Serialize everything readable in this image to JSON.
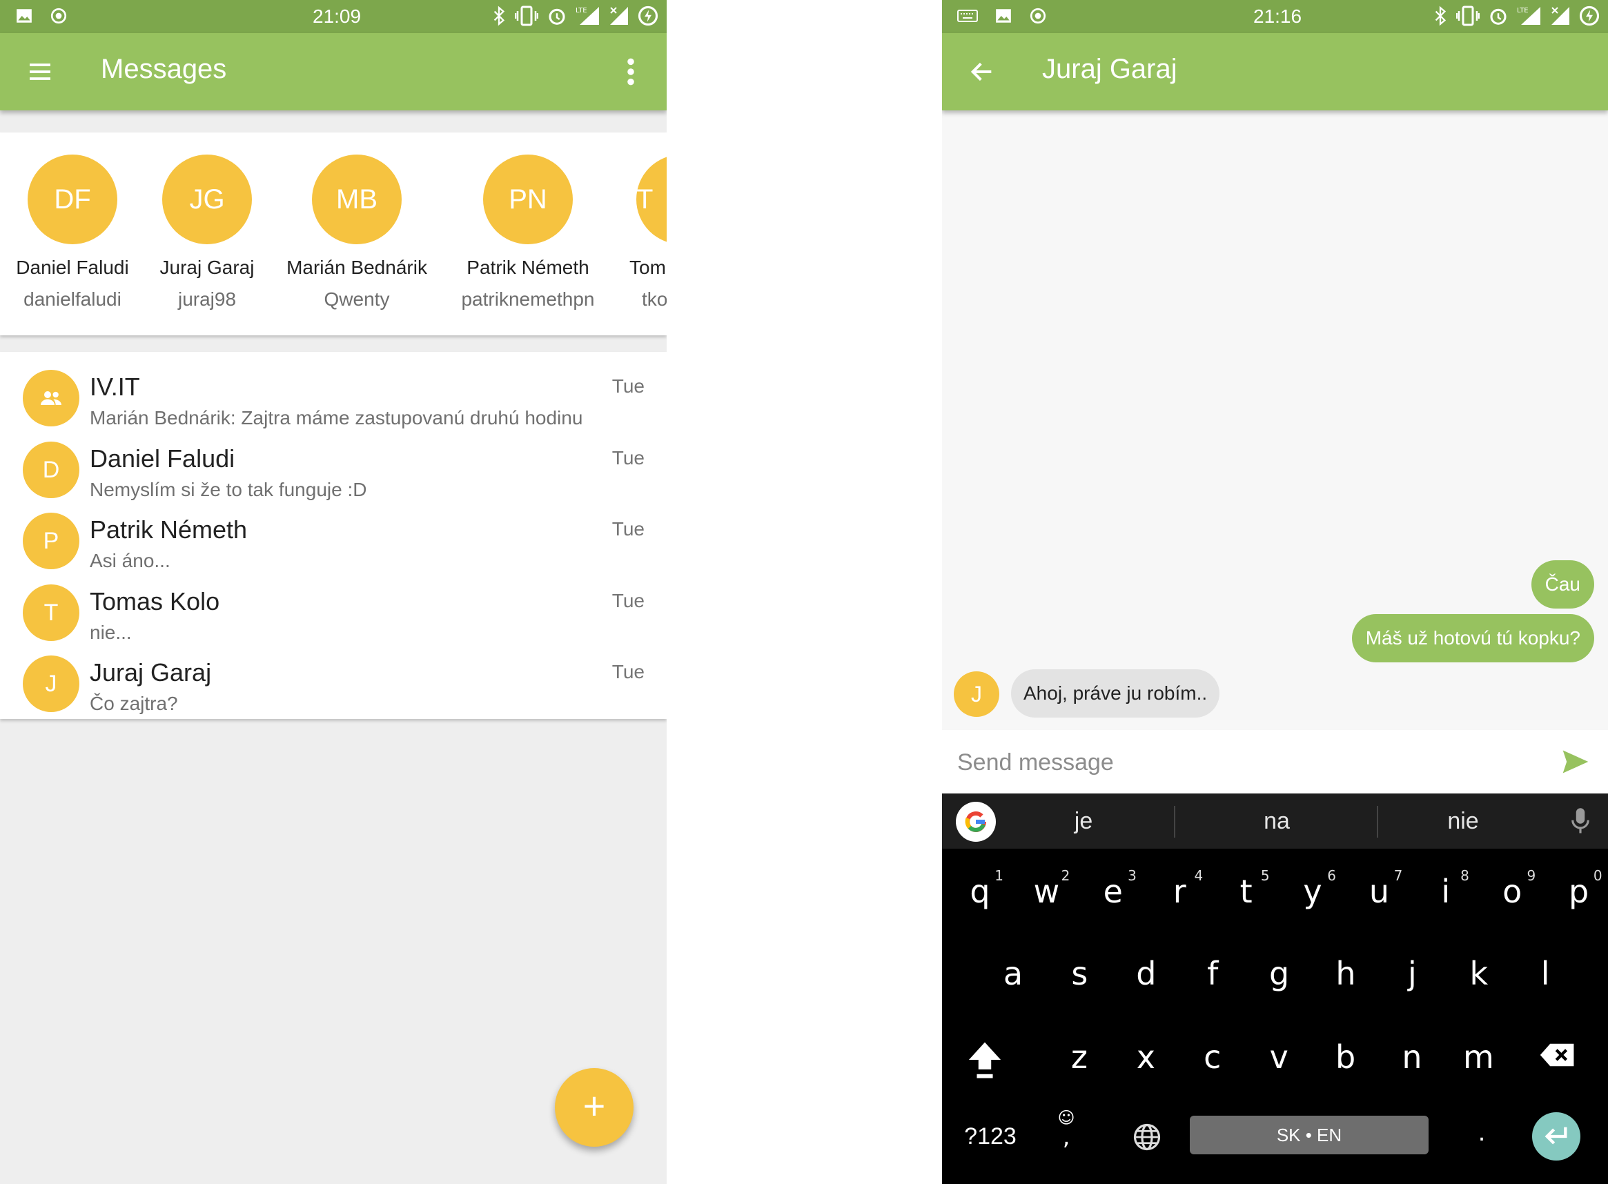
{
  "left": {
    "status": {
      "time": "21:09"
    },
    "appbar": {
      "title": "Messages"
    },
    "contacts": [
      {
        "initials": "DF",
        "name": "Daniel Faludi",
        "username": "danielfaludi"
      },
      {
        "initials": "JG",
        "name": "Juraj Garaj",
        "username": "juraj98"
      },
      {
        "initials": "MB",
        "name": "Marián Bednárik",
        "username": "Qwenty"
      },
      {
        "initials": "PN",
        "name": "Patrik Németh",
        "username": "patriknemethpn"
      },
      {
        "initials": "T",
        "name": "Tom",
        "username": "tko"
      }
    ],
    "conversations": [
      {
        "avatar": "",
        "title": "IV.IT",
        "snippet": "Marián Bednárik: Zajtra máme zastupovanú druhú hodinu",
        "time": "Tue"
      },
      {
        "avatar": "D",
        "title": "Daniel Faludi",
        "snippet": "Nemyslím si že to tak funguje :D",
        "time": "Tue"
      },
      {
        "avatar": "P",
        "title": "Patrik Németh",
        "snippet": "Asi áno...",
        "time": "Tue"
      },
      {
        "avatar": "T",
        "title": "Tomas Kolo",
        "snippet": "nie...",
        "time": "Tue"
      },
      {
        "avatar": "J",
        "title": "Juraj Garaj",
        "snippet": "Čo zajtra?",
        "time": "Tue"
      }
    ],
    "fab": {
      "label": "+"
    }
  },
  "right": {
    "status": {
      "time": "21:16"
    },
    "appbar": {
      "title": "Juraj Garaj"
    },
    "messages": [
      {
        "direction": "out",
        "text": "Čau"
      },
      {
        "direction": "out",
        "text": "Máš už hotovú tú kopku?"
      },
      {
        "direction": "in",
        "avatar": "J",
        "text": "Ahoj, práve ju robím.."
      }
    ],
    "composer": {
      "placeholder": "Send message",
      "value": ""
    },
    "keyboard": {
      "suggestions": [
        "je",
        "na",
        "nie"
      ],
      "row1": [
        "q",
        "w",
        "e",
        "r",
        "t",
        "y",
        "u",
        "i",
        "o",
        "p"
      ],
      "row1_hints": [
        "1",
        "2",
        "3",
        "4",
        "5",
        "6",
        "7",
        "8",
        "9",
        "0"
      ],
      "row2": [
        "a",
        "s",
        "d",
        "f",
        "g",
        "h",
        "j",
        "k",
        "l"
      ],
      "row3": [
        "z",
        "x",
        "c",
        "v",
        "b",
        "n",
        "m"
      ],
      "symbols_key": "?123",
      "comma": ",",
      "emoji_hint": "☺",
      "period": ".",
      "space_label": "SK • EN"
    }
  },
  "colors": {
    "status_bar": "#7da74c",
    "app_bar": "#97c25f",
    "avatar": "#f6c340",
    "outgoing_bubble": "#97c25f",
    "incoming_bubble": "#e3e3e3",
    "enter_key": "#85c9c0"
  }
}
